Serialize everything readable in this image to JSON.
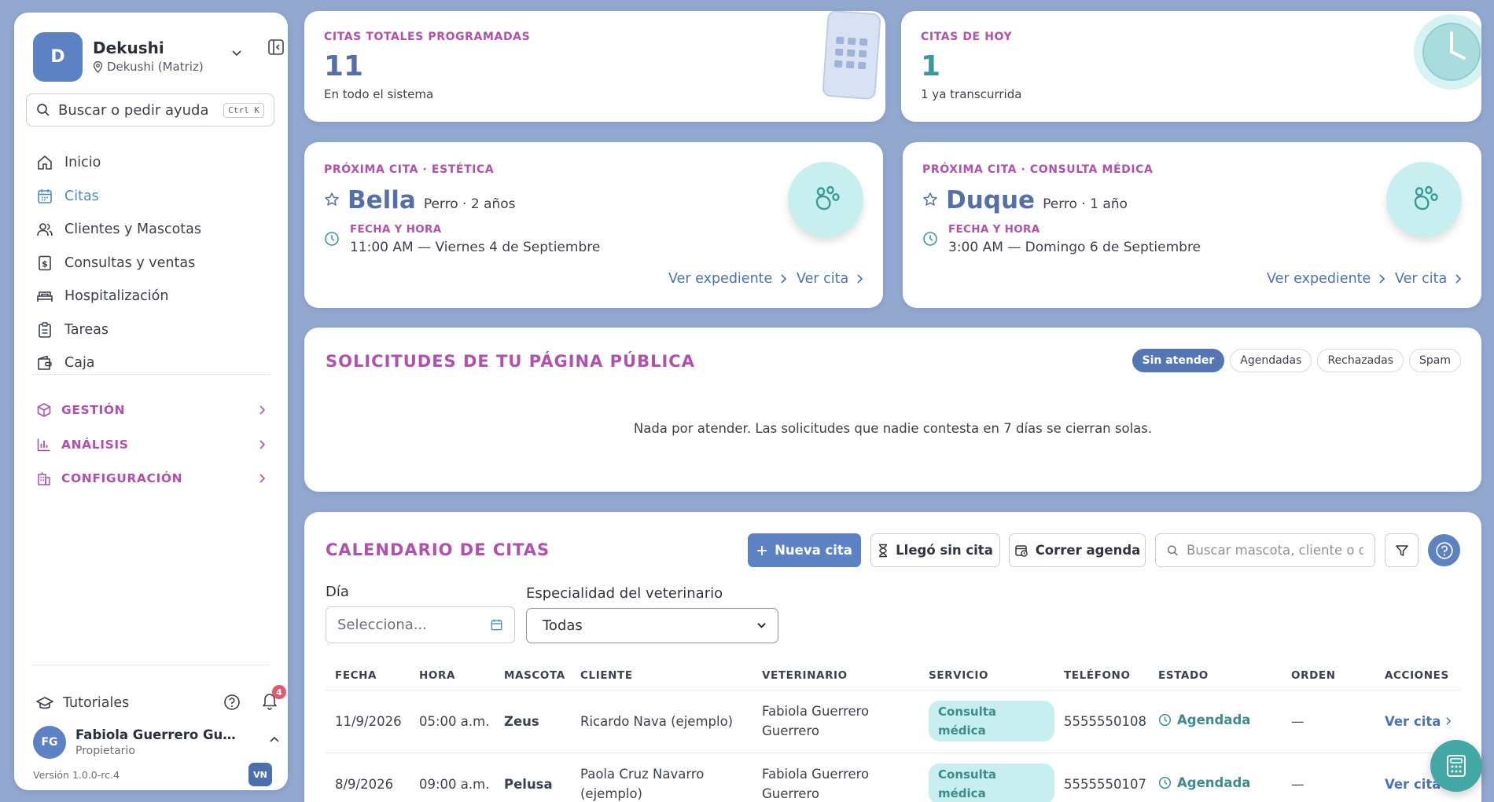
{
  "account": {
    "initial": "D",
    "name": "Dekushi",
    "branch": "Dekushi (Matriz)"
  },
  "search": {
    "placeholder": "Buscar o pedir ayuda",
    "shortcut": "Ctrl K"
  },
  "nav": [
    {
      "label": "Inicio",
      "icon": "home-icon"
    },
    {
      "label": "Citas",
      "icon": "calendar-icon",
      "active": true
    },
    {
      "label": "Clientes y Mascotas",
      "icon": "users-icon"
    },
    {
      "label": "Consultas y ventas",
      "icon": "receipt-icon"
    },
    {
      "label": "Hospitalización",
      "icon": "bed-icon"
    },
    {
      "label": "Tareas",
      "icon": "clipboard-icon"
    },
    {
      "label": "Caja",
      "icon": "wallet-icon"
    }
  ],
  "sections": [
    {
      "label": "GESTIÓN",
      "icon": "box-icon"
    },
    {
      "label": "ANÁLISIS",
      "icon": "chart-icon"
    },
    {
      "label": "CONFIGURACIÓN",
      "icon": "building-icon"
    }
  ],
  "footer": {
    "tutorials": "Tutoriales",
    "notifications": "4",
    "user_initials": "FG",
    "user_name": "Fabiola Guerrero Guerrero",
    "user_role": "Propietario",
    "version": "Versión 1.0.0-rc.4",
    "vn": "VN"
  },
  "stats": {
    "total": {
      "label": "CITAS TOTALES PROGRAMADAS",
      "value": "11",
      "sub": "En todo el sistema"
    },
    "today": {
      "label": "CITAS DE HOY",
      "value": "1",
      "sub": "1 ya transcurrida"
    }
  },
  "next": [
    {
      "label": "PRÓXIMA CITA · ESTÉTICA",
      "pet": "Bella",
      "detail": "Perro · 2 años",
      "date_label": "FECHA Y HORA",
      "date": "11:00 AM — Viernes 4 de Septiembre",
      "link1": "Ver expediente",
      "link2": "Ver cita"
    },
    {
      "label": "PRÓXIMA CITA · CONSULTA MÉDICA",
      "pet": "Duque",
      "detail": "Perro · 1 año",
      "date_label": "FECHA Y HORA",
      "date": "3:00 AM — Domingo 6 de Septiembre",
      "link1": "Ver expediente",
      "link2": "Ver cita"
    }
  ],
  "requests": {
    "title": "SOLICITUDES DE TU PÁGINA PÚBLICA",
    "filters": [
      "Sin atender",
      "Agendadas",
      "Rechazadas",
      "Spam"
    ],
    "empty": "Nada por atender. Las solicitudes que nadie contesta en 7 días se cierran solas."
  },
  "calendar": {
    "title": "CALENDARIO DE CITAS",
    "new": "Nueva cita",
    "walkin": "Llegó sin cita",
    "shift": "Correr agenda",
    "search_placeholder": "Buscar mascota, cliente o do",
    "day_label": "Día",
    "day_placeholder": "Selecciona...",
    "spec_label": "Especialidad del veterinario",
    "spec_value": "Todas",
    "columns": [
      "FECHA",
      "HORA",
      "MASCOTA",
      "CLIENTE",
      "VETERINARIO",
      "SERVICIO",
      "TELÉFONO",
      "ESTADO",
      "ORDEN",
      "ACCIONES"
    ],
    "rows": [
      {
        "fecha": "11/9/2026",
        "hora": "05:00 a.m.",
        "mascota": "Zeus",
        "cliente": "Ricardo Nava (ejemplo)",
        "vet": "Fabiola Guerrero Guerrero",
        "servicio": "Consulta médica",
        "tel": "5555550108",
        "estado": "Agendada",
        "orden": "—",
        "accion": "Ver cita"
      },
      {
        "fecha": "8/9/2026",
        "hora": "09:00 a.m.",
        "mascota": "Pelusa",
        "cliente": "Paola Cruz Navarro (ejemplo)",
        "vet": "Fabiola Guerrero Guerrero",
        "servicio": "Consulta médica",
        "tel": "5555550107",
        "estado": "Agendada",
        "orden": "—",
        "accion": "Ver cita"
      }
    ]
  },
  "colors": {
    "accent": "#5d82c3",
    "magenta": "#b34fae",
    "teal": "#3b8d8c",
    "background": "#93a8cf"
  }
}
